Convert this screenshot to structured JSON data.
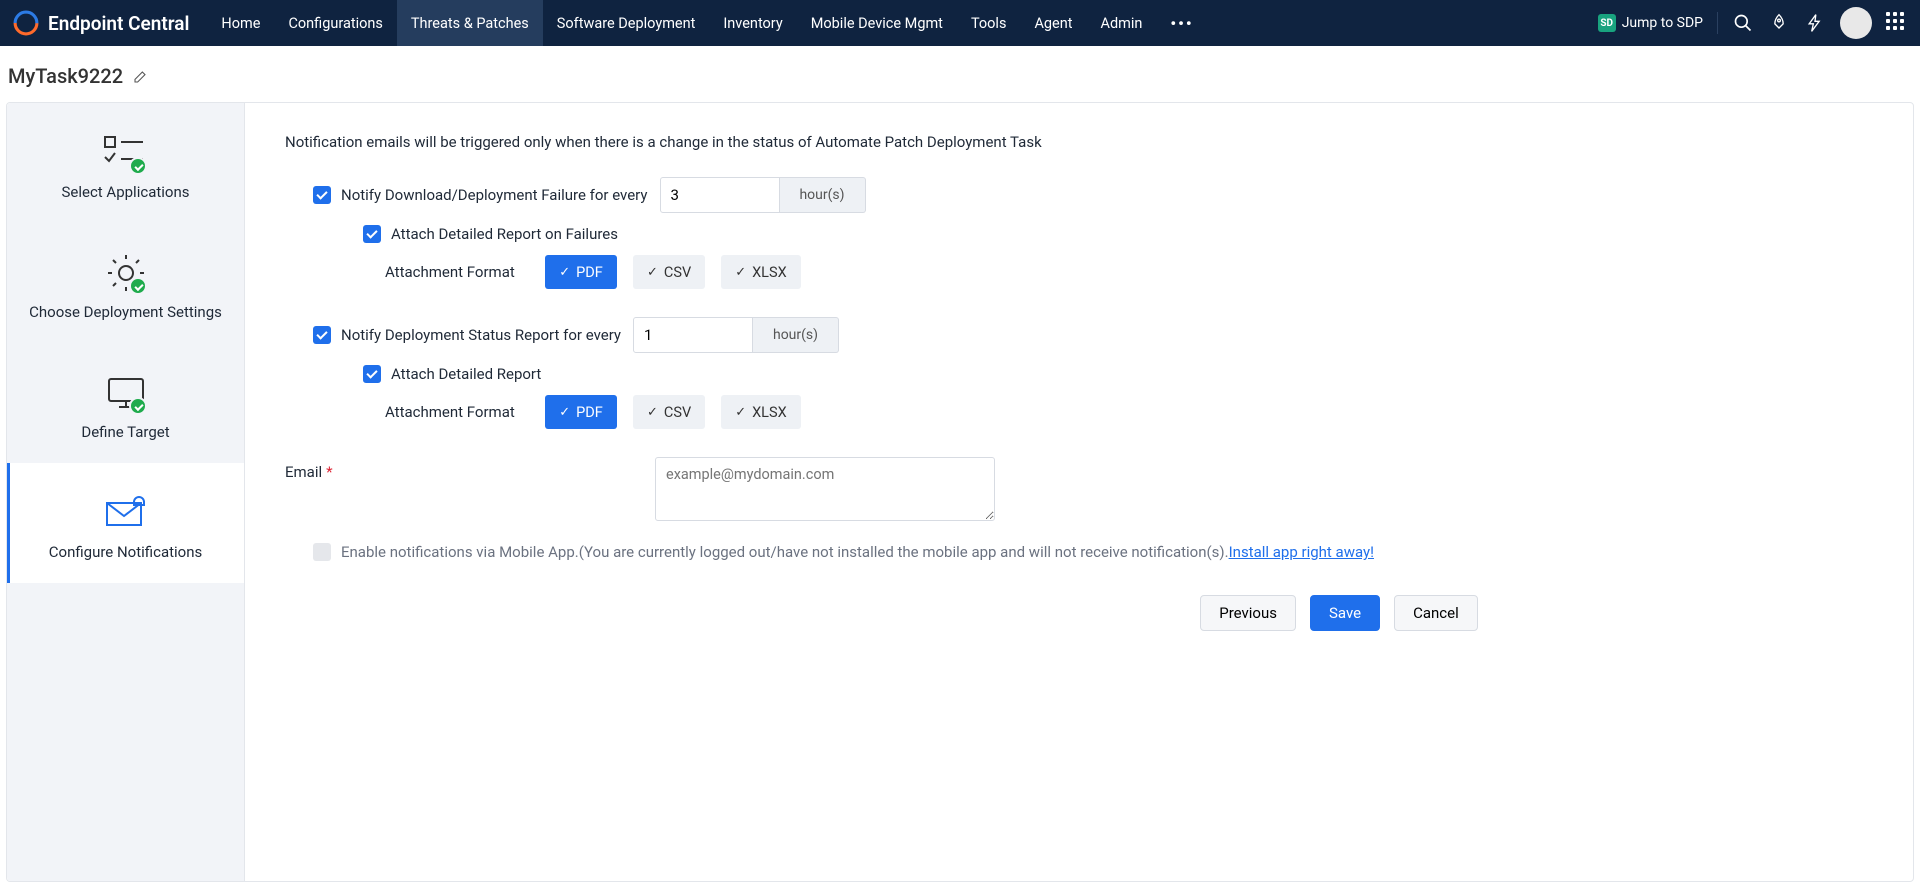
{
  "brand": "Endpoint Central",
  "nav": {
    "home": "Home",
    "configurations": "Configurations",
    "threats": "Threats & Patches",
    "software": "Software Deployment",
    "inventory": "Inventory",
    "mdm": "Mobile Device Mgmt",
    "tools": "Tools",
    "agent": "Agent",
    "admin": "Admin",
    "more": "•••"
  },
  "top_right": {
    "jump": "Jump to SDP"
  },
  "task_title": "MyTask9222",
  "steps": {
    "s1": "Select Applications",
    "s2": "Choose Deployment Settings",
    "s3": "Define Target",
    "s4": "Configure Notifications"
  },
  "main": {
    "info": "Notification emails will be triggered only when there is a change in the status of Automate Patch Deployment Task",
    "notify_failure_label": "Notify Download/Deployment Failure for every",
    "failure_value": "3",
    "hours_unit": "hour(s)",
    "attach_failures": "Attach Detailed Report on Failures",
    "attachment_format_label": "Attachment Format",
    "fmt_pdf": "PDF",
    "fmt_csv": "CSV",
    "fmt_xlsx": "XLSX",
    "notify_status_label": "Notify Deployment Status Report for every",
    "status_value": "1",
    "attach_detailed": "Attach Detailed Report",
    "email_label": "Email",
    "email_placeholder": "example@mydomain.com",
    "mobile_prefix": "Enable notifications via Mobile App.(You are currently logged out/have not installed the mobile app and will not receive notification(s). ",
    "mobile_link": "Install app right away!",
    "btn_prev": "Previous",
    "btn_save": "Save",
    "btn_cancel": "Cancel"
  }
}
